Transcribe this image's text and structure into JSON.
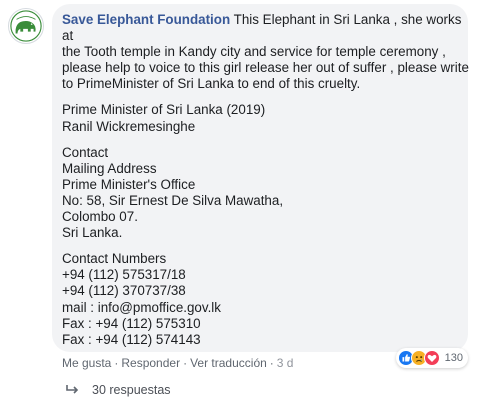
{
  "comment": {
    "author": "Save Elephant Foundation",
    "avatar_icon": "elephant-logo-icon",
    "blocks": [
      {
        "lines": [
          "This Elephant in Sri Lanka , she works",
          "at",
          "the Tooth temple in Kandy city and service for temple ceremony ,",
          "please help to voice to this girl release her out of suffer , please write",
          "to PrimeMinister of Sri Lanka to end of this cruelty."
        ]
      },
      {
        "lines": [
          "Prime Minister of Sri Lanka (2019)",
          "Ranil Wickremesinghe"
        ]
      },
      {
        "lines": [
          "Contact",
          "Mailing Address",
          "Prime Minister's Office",
          "No: 58, Sir Ernest De Silva Mawatha,",
          "Colombo 07.",
          "Sri Lanka."
        ]
      },
      {
        "lines": [
          "Contact Numbers",
          "+94 (112) 575317/18",
          "+94 (112) 370737/38",
          "mail : info@pmoffice.gov.lk",
          "Fax : +94 (112) 575310",
          "Fax : +94 (112) 574143"
        ]
      }
    ]
  },
  "actions": {
    "like": "Me gusta",
    "separator": "·",
    "reply": "Responder",
    "translate": "Ver traducción",
    "time": "3 d"
  },
  "reactions": {
    "icons": [
      "like-icon",
      "sad-icon",
      "love-icon"
    ],
    "count": "130",
    "colors": {
      "like": "#1877f2",
      "sad": "#f7b125",
      "love": "#f33e58"
    }
  },
  "replies": {
    "icon": "reply-arrow-icon",
    "label": "30 respuestas"
  },
  "colors": {
    "author": "#385898",
    "bubble": "#f2f3f5",
    "meta": "#606770"
  }
}
